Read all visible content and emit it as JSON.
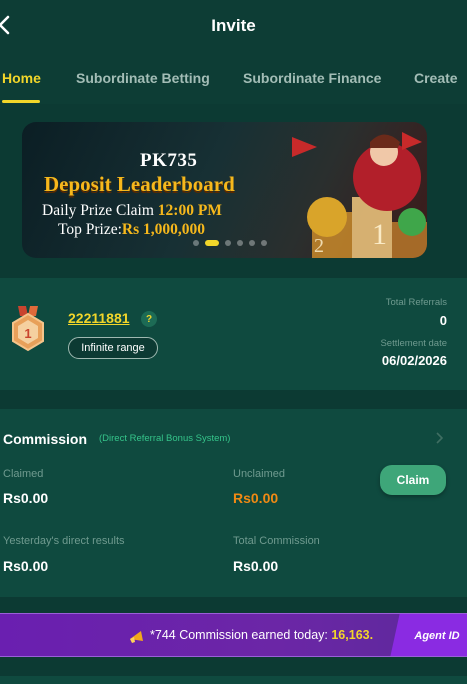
{
  "header": {
    "title": "Invite"
  },
  "tabs": [
    {
      "label": "Home",
      "active": true
    },
    {
      "label": "Subordinate Betting",
      "active": false
    },
    {
      "label": "Subordinate Finance",
      "active": false
    },
    {
      "label": "Create",
      "active": false
    }
  ],
  "banner": {
    "brand": "PK735",
    "headline": "Deposit Leaderboard",
    "line1_prefix": "Daily Prize Claim",
    "line1_value": "12:00 PM",
    "line2_prefix": "Top Prize:",
    "line2_value": "Rs 1,000,000",
    "active_slide": 2,
    "slide_count": 6
  },
  "stats": {
    "user_id": "22211881",
    "help_glyph": "?",
    "range_label": "Infinite range",
    "total_referrals_label": "Total Referrals",
    "total_referrals_value": "0",
    "settlement_label": "Settlement date",
    "settlement_value": "06/02/2026"
  },
  "commission": {
    "title": "Commission",
    "subtitle": "(Direct Referral Bonus System)",
    "claimed_label": "Claimed",
    "claimed_value": "Rs0.00",
    "unclaimed_label": "Unclaimed",
    "unclaimed_value": "Rs0.00",
    "claim_button": "Claim",
    "yesterday_label": "Yesterday's direct results",
    "yesterday_value": "Rs0.00",
    "total_label": "Total Commission",
    "total_value": "Rs0.00"
  },
  "ticker": {
    "text": "*744 Commission earned today:",
    "amount": "16,163.",
    "agent_label": "Agent ID"
  },
  "colors": {
    "accent": "#f2d62a",
    "background": "#0c3a33",
    "card": "#0f4a3f",
    "claim_button": "#3ea679",
    "unclaimed": "#f08a14",
    "ticker": "#6a1fb0"
  },
  "icons": [
    "back-icon",
    "medal-icon",
    "help-icon",
    "chevron-right-icon",
    "speaker-icon"
  ]
}
